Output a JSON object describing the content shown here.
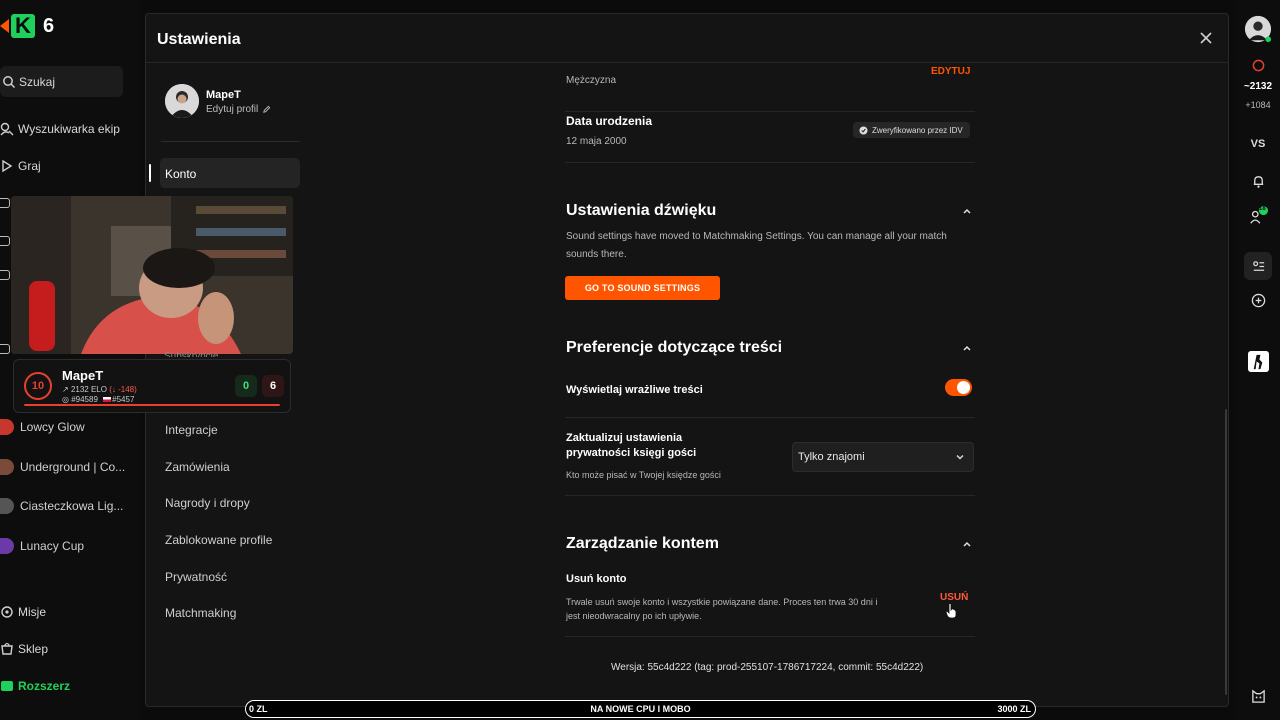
{
  "app": {
    "logo_text": "6",
    "search_label": "Szukaj",
    "nav": [
      {
        "label": "Wyszukiwarka ekip"
      },
      {
        "label": "Graj"
      }
    ],
    "clubs": [
      {
        "label": "Lowcy Glow",
        "color": "#c8372d"
      },
      {
        "label": "Underground | Co...",
        "color": "#7a4b3a"
      },
      {
        "label": "Ciasteczkowa Lig...",
        "color": "#555555"
      },
      {
        "label": "Lunacy Cup",
        "color": "#6b3aa8"
      }
    ],
    "bottom_nav": [
      {
        "label": "Misje"
      },
      {
        "label": "Sklep"
      },
      {
        "label": "Rozszerz"
      }
    ]
  },
  "stream_overlay": {
    "level": "10",
    "name": "MapeT",
    "elo_value": "2132",
    "elo_label": "ELO",
    "elo_change": "(↓ -148)",
    "rank_region": "#94589",
    "rank_country": "#5457",
    "wins": "0",
    "losses": "6",
    "hidden_menu_fragment": "Subskrypcje"
  },
  "right_rail": {
    "elo": "2132",
    "delta": "+1084",
    "vs_label": "VS",
    "friends_badge": "18"
  },
  "modal": {
    "title": "Ustawienia",
    "profile": {
      "name": "MapeT",
      "edit_label": "Edytuj profil"
    },
    "menu": [
      {
        "label": "Konto",
        "active": true
      },
      {
        "label": "Integracje"
      },
      {
        "label": "Zamówienia"
      },
      {
        "label": "Nagrody i dropy"
      },
      {
        "label": "Zablokowane profile"
      },
      {
        "label": "Prywatność"
      },
      {
        "label": "Matchmaking"
      }
    ],
    "gender": {
      "value": "Mężczyzna",
      "edit_label": "EDYTUJ"
    },
    "birthdate": {
      "label": "Data urodzenia",
      "value": "12 maja 2000",
      "badge": "Zweryfikowano przez IDV"
    },
    "sound": {
      "title": "Ustawienia dźwięku",
      "desc_line1": "Sound settings have moved to Matchmaking Settings. You can manage all your match",
      "desc_line2": "sounds there.",
      "button": "GO TO SOUND SETTINGS"
    },
    "content_prefs": {
      "title": "Preferencje dotyczące treści",
      "sensitive_label": "Wyświetlaj wrażliwe treści",
      "sensitive_enabled": true,
      "guestbook_label_line1": "Zaktualizuj ustawienia",
      "guestbook_label_line2": "prywatności księgi gości",
      "guestbook_desc": "Kto może pisać w Twojej księdze gości",
      "guestbook_value": "Tylko znajomi"
    },
    "account_mgmt": {
      "title": "Zarządzanie kontem",
      "delete_label": "Usuń konto",
      "delete_desc_line1": "Trwale usuń swoje konto i wszystkie powiązane dane. Proces ten trwa 30 dni i",
      "delete_desc_line2": "jest nieodwracalny po ich upływie.",
      "delete_button": "USUŃ"
    },
    "version": "Wersja: 55c4d222 (tag: prod-255107-1786717224, commit: 55c4d222)"
  },
  "goal_bar": {
    "start": "0 ZL",
    "title": "NA NOWE CPU I MOBO",
    "end": "3000 ZL",
    "progress": 0
  },
  "colors": {
    "accent": "#ff5500",
    "brand_green": "#1fd15a",
    "danger": "#ff5a3c"
  }
}
